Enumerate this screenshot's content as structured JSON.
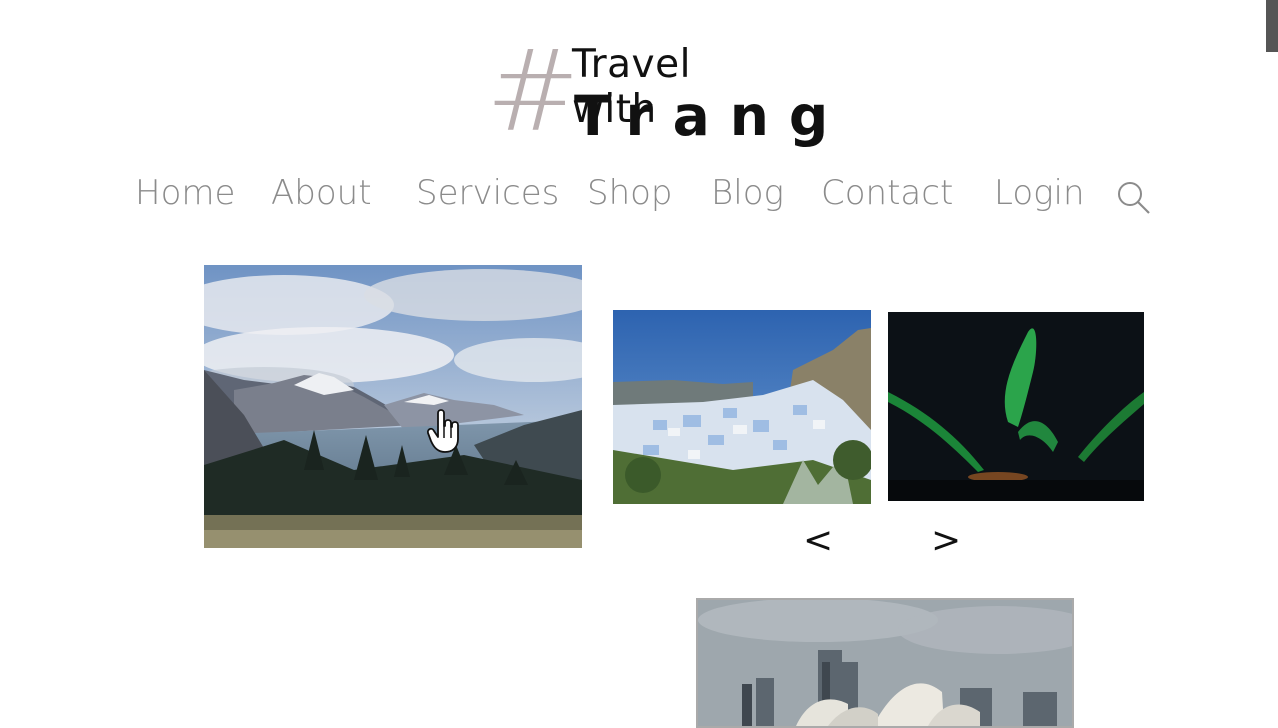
{
  "logo": {
    "hash": "#",
    "line1": "Travel with",
    "line2": "Trang"
  },
  "nav": {
    "items": [
      {
        "label": "Home"
      },
      {
        "label": "About"
      },
      {
        "label": "Services"
      },
      {
        "label": "Shop"
      },
      {
        "label": "Blog"
      },
      {
        "label": "Contact"
      },
      {
        "label": "Login"
      }
    ],
    "search_icon": "search-icon"
  },
  "gallery": {
    "prev_label": "<",
    "next_label": ">",
    "images": [
      {
        "subject": "lake-mountains"
      },
      {
        "subject": "blue-city-hillside"
      },
      {
        "subject": "aurora-borealis"
      },
      {
        "subject": "sydney-opera-house"
      }
    ]
  },
  "colors": {
    "nav_text": "#8b8b8b",
    "logo_hash": "#b9afb0",
    "logo_text": "#111111"
  }
}
